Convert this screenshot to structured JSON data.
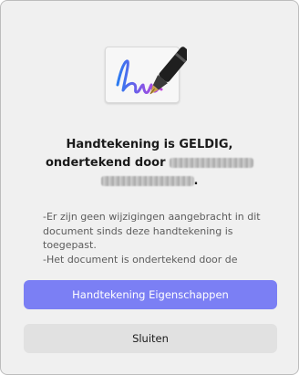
{
  "dialog": {
    "title_line1": "Handtekening is GELDIG,",
    "title_line2_prefix": "ondertekend door",
    "title_line3_suffix": ".",
    "message_line1": "-Er zijn geen wijzigingen aangebracht in dit document sinds deze handtekening is toegepast.",
    "message_line2": "-Het document is ondertekend door de"
  },
  "buttons": {
    "properties_label": "Handtekening Eigenschappen",
    "close_label": "Sluiten"
  },
  "colors": {
    "primary": "#7b7ff4",
    "secondary": "#e1e1e1",
    "background": "#f0f0f0"
  },
  "icons": {
    "signature": "signature-pen-icon"
  }
}
